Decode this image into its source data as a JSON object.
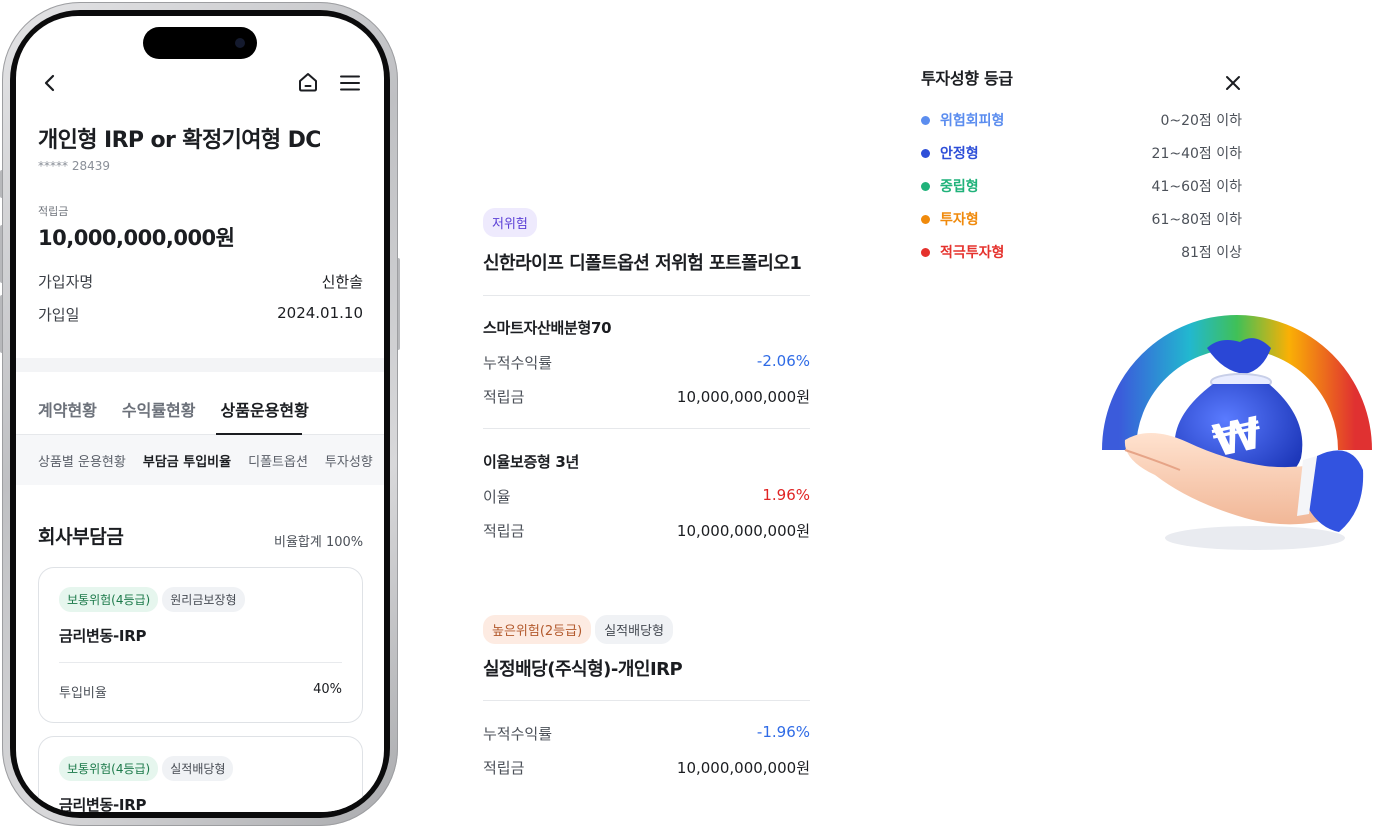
{
  "phone": {
    "header": {
      "back_icon": "chevron-left-icon",
      "home_icon": "home-icon",
      "menu_icon": "hamburger-menu-icon"
    },
    "title": "개인형 IRP or 확정기여형 DC",
    "account_number": "***** 28439",
    "balance_label": "적립금",
    "balance": "10,000,000,000원",
    "info_rows": [
      {
        "label": "가입자명",
        "value": "신한솔"
      },
      {
        "label": "가입일",
        "value": "2024.01.10"
      }
    ],
    "tabs": [
      "계약현황",
      "수익률현황",
      "상품운용현황"
    ],
    "active_tab": "상품운용현황",
    "subtabs": [
      "상품별 운용현황",
      "부담금 투입비율",
      "디폴트옵션",
      "투자성향"
    ],
    "active_subtab": "부담금 투입비율",
    "section_title": "회사부담금",
    "section_sum": "비율합계 100%",
    "cards": [
      {
        "chips": [
          "보통위험(4등급)",
          "원리금보장형"
        ],
        "name": "금리변동-IRP",
        "row_label": "투입비율",
        "row_value": "40%"
      },
      {
        "chips": [
          "보통위험(4등급)",
          "실적배당형"
        ],
        "name": "금리변동-IRP"
      }
    ]
  },
  "middle": {
    "block1": {
      "chip": "저위험",
      "title": "신한라이프 디폴트옵션 저위험 포트폴리오1",
      "items": [
        {
          "name": "스마트자산배분형70",
          "rows": [
            {
              "label": "누적수익률",
              "value": "-2.06%",
              "color": "#2f6be6"
            },
            {
              "label": "적립금",
              "value": "10,000,000,000원"
            }
          ]
        },
        {
          "name": "이율보증형 3년",
          "rows": [
            {
              "label": "이율",
              "value": "1.96%",
              "color": "#e02424"
            },
            {
              "label": "적립금",
              "value": "10,000,000,000원"
            }
          ]
        }
      ]
    },
    "block2": {
      "chips": [
        "높은위험(2등급)",
        "실적배당형"
      ],
      "title": "실정배당(주식형)-개인IRP",
      "rows": [
        {
          "label": "누적수익률",
          "value": "-1.96%",
          "color": "#2f6be6"
        },
        {
          "label": "적립금",
          "value": "10,000,000,000원"
        }
      ]
    }
  },
  "right": {
    "title": "투자성향 등급",
    "close_icon": "close-icon",
    "grades": [
      {
        "name": "위험회피형",
        "range": "0~20점 이하",
        "color": "#5b8def"
      },
      {
        "name": "안정형",
        "range": "21~40점 이하",
        "color": "#2e4fd8"
      },
      {
        "name": "중립형",
        "range": "41~60점 이하",
        "color": "#20b27a"
      },
      {
        "name": "투자형",
        "range": "61~80점 이하",
        "color": "#f08a0c"
      },
      {
        "name": "적극투자형",
        "range": "81점 이상",
        "color": "#e5322d"
      }
    ],
    "illustration": "hand-holding-money-bag-gauge",
    "bag_symbol": "₩"
  }
}
